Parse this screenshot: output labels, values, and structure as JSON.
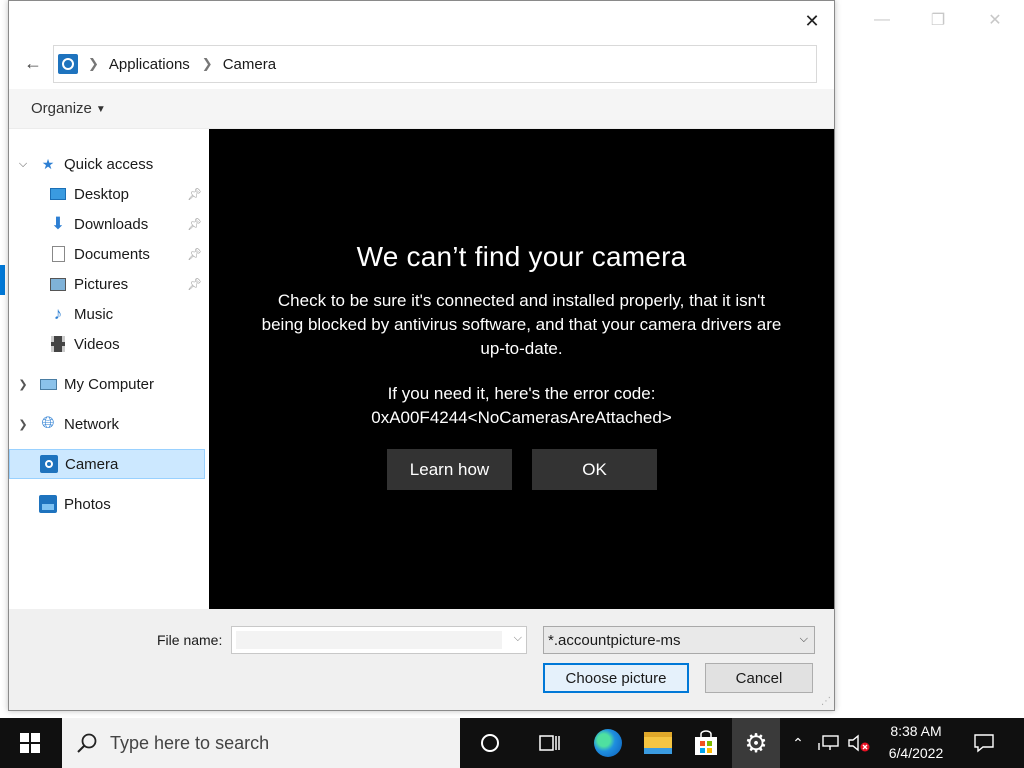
{
  "background_window": {
    "controls": [
      "minimize-icon",
      "maximize-icon",
      "close-icon"
    ]
  },
  "dialog": {
    "close_icon": "close-icon",
    "breadcrumb": [
      "Applications",
      "Camera"
    ],
    "organize_label": "Organize",
    "nav": {
      "quick_access": "Quick access",
      "items": [
        {
          "label": "Desktop",
          "icon": "desktop-icon",
          "pinned": true
        },
        {
          "label": "Downloads",
          "icon": "download-icon",
          "pinned": true
        },
        {
          "label": "Documents",
          "icon": "documents-icon",
          "pinned": true
        },
        {
          "label": "Pictures",
          "icon": "pictures-icon",
          "pinned": true
        },
        {
          "label": "Music",
          "icon": "music-icon",
          "pinned": false
        },
        {
          "label": "Videos",
          "icon": "videos-icon",
          "pinned": false
        }
      ],
      "my_computer": "My Computer",
      "network": "Network",
      "camera": "Camera",
      "photos": "Photos"
    },
    "camera_error": {
      "title": "We can’t find your camera",
      "body": "Check to be sure it's connected and installed properly, that it isn't being blocked by antivirus software, and that your camera drivers are up-to-date.",
      "code_label": "If you need it, here's the error code:",
      "code": "0xA00F4244<NoCamerasAreAttached>",
      "learn_how": "Learn how",
      "ok": "OK"
    },
    "file_name_label": "File name:",
    "file_name_value": "",
    "file_type": "*.accountpicture-ms",
    "choose_label": "Choose picture",
    "cancel_label": "Cancel"
  },
  "taskbar": {
    "search_placeholder": "Type here to search",
    "time": "8:38 AM",
    "date": "6/4/2022",
    "accent": "#0078d7"
  }
}
